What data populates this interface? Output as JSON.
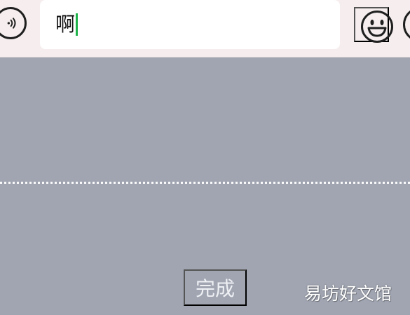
{
  "input_bar": {
    "voice_icon": "voice-wave-icon",
    "text_value": "啊",
    "caret_color": "#1fb34b",
    "emoji_icon": "smile-emoji-icon",
    "more_icon": "plus-circle-icon"
  },
  "keyboard": {
    "done_label": "完成"
  },
  "watermark": {
    "text": "易坊好文馆"
  },
  "colors": {
    "input_bar_background": "#f6eeee",
    "keyboard_background": "#a0a5b1",
    "text_field_background": "#ffffff"
  }
}
